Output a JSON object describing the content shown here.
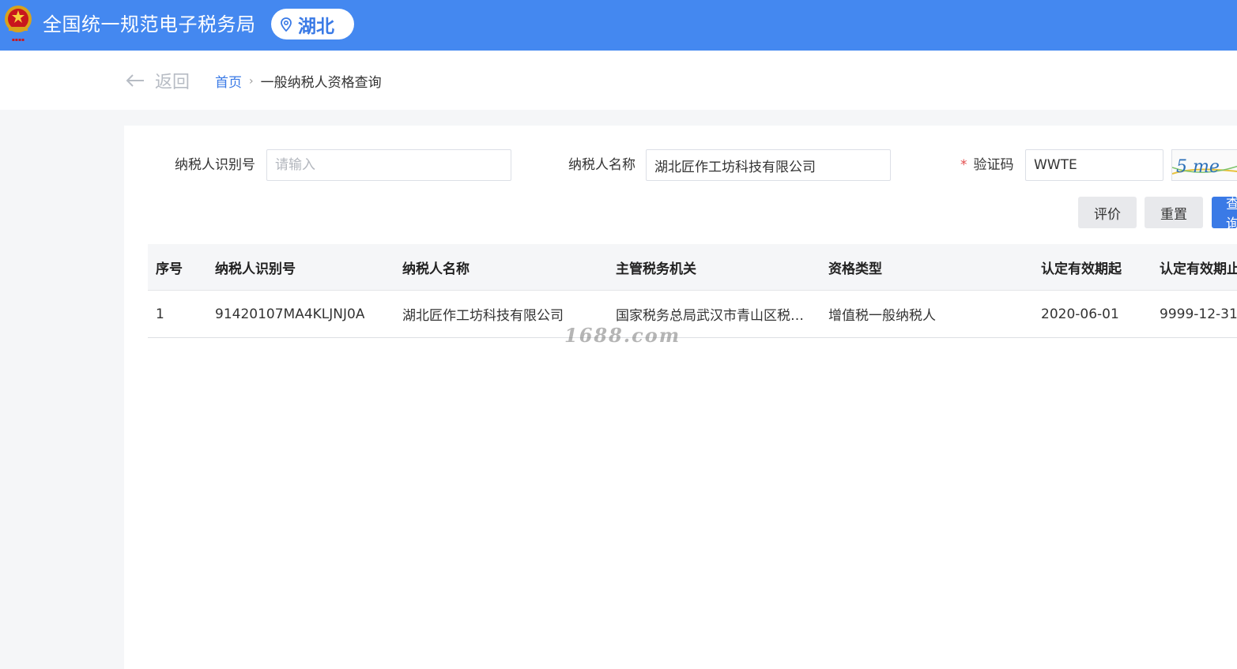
{
  "header": {
    "site_title": "全国统一规范电子税务局",
    "region": "湖北",
    "brand_color": "#4488f0",
    "emblem_icon": "national-emblem-icon",
    "region_icon": "location-pin-icon"
  },
  "breadcrumb": {
    "back_label": "返回",
    "home": "首页",
    "current": "一般纳税人资格查询"
  },
  "form": {
    "taxpayer_id_label": "纳税人识别号",
    "taxpayer_id_value": "",
    "taxpayer_id_placeholder": "请输入",
    "taxpayer_name_label": "纳税人名称",
    "taxpayer_name_value": "湖北匠作工坊科技有限公司",
    "captcha_required_mark": "*",
    "captcha_label": "验证码",
    "captcha_value": "WWTE",
    "captcha_image_text": "5 me"
  },
  "buttons": {
    "evaluate": "评价",
    "reset": "重置",
    "query": "查询"
  },
  "table": {
    "columns": [
      "序号",
      "纳税人识别号",
      "纳税人名称",
      "主管税务机关",
      "资格类型",
      "认定有效期起",
      "认定有效期止"
    ],
    "rows": [
      [
        "1",
        "91420107MA4KLJNJ0A",
        "湖北匠作工坊科技有限公司",
        "国家税务总局武汉市青山区税…",
        "增值税一般纳税人",
        "2020-06-01",
        "9999-12-31"
      ]
    ]
  },
  "watermark": "1688.com"
}
